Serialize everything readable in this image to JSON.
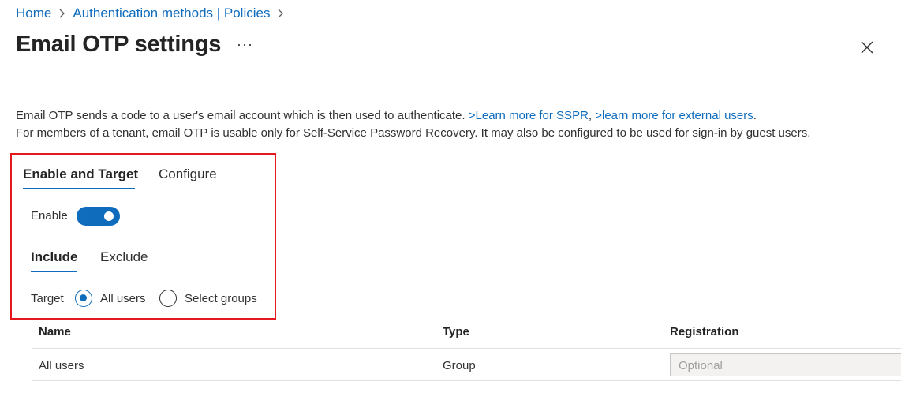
{
  "breadcrumb": {
    "items": [
      "Home",
      "Authentication methods | Policies"
    ]
  },
  "header": {
    "title": "Email OTP settings",
    "more_label": "···"
  },
  "description": {
    "line1_text": "Email OTP sends a code to a user's email account which is then used to authenticate. ",
    "link_sspr": ">Learn more for SSPR",
    "comma": ", ",
    "link_external": ">learn more for external users",
    "period": ".",
    "line2_text": "For members of a tenant, email OTP is usable only for Self-Service Password Recovery. It may also be configured to be used for sign-in by guest users."
  },
  "tabs": {
    "enable_target": "Enable and Target",
    "configure": "Configure"
  },
  "enable": {
    "label": "Enable",
    "value": true
  },
  "subtabs": {
    "include": "Include",
    "exclude": "Exclude"
  },
  "target": {
    "label": "Target",
    "options": [
      "All users",
      "Select groups"
    ],
    "selected": "All users"
  },
  "table": {
    "columns": [
      "Name",
      "Type",
      "Registration"
    ],
    "rows": [
      {
        "name": "All users",
        "type": "Group",
        "registration_placeholder": "Optional"
      }
    ]
  },
  "colors": {
    "accent": "#0f6cbd",
    "highlight": "#e3191e"
  }
}
